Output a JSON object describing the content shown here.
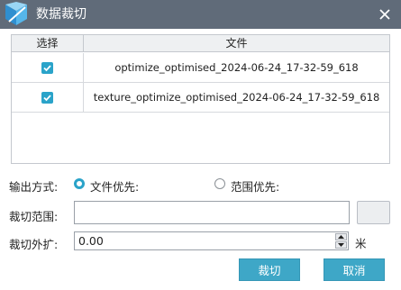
{
  "window": {
    "title": "数据裁切"
  },
  "table": {
    "columns": [
      "选择",
      "文件"
    ],
    "rows": [
      {
        "checked": true,
        "file": "optimize_optimised_2024-06-24_17-32-59_618"
      },
      {
        "checked": true,
        "file": "texture_optimize_optimised_2024-06-24_17-32-59_618"
      }
    ]
  },
  "output_mode": {
    "label": "输出方式:",
    "options": [
      {
        "label": "文件优先:",
        "selected": true
      },
      {
        "label": "范围优先:",
        "selected": false
      }
    ]
  },
  "clip_range": {
    "label": "裁切范围:",
    "value": ""
  },
  "clip_buffer": {
    "label": "裁切外扩:",
    "value": "0.00",
    "unit": "米"
  },
  "buttons": {
    "ok": "裁切",
    "cancel": "取消"
  },
  "colors": {
    "titlebar": "#606b79",
    "accent": "#2aa3c9",
    "button": "#3ea7c7"
  },
  "icons": {
    "logo": "app-logo-icon",
    "close": "close-icon",
    "check": "check-icon"
  }
}
